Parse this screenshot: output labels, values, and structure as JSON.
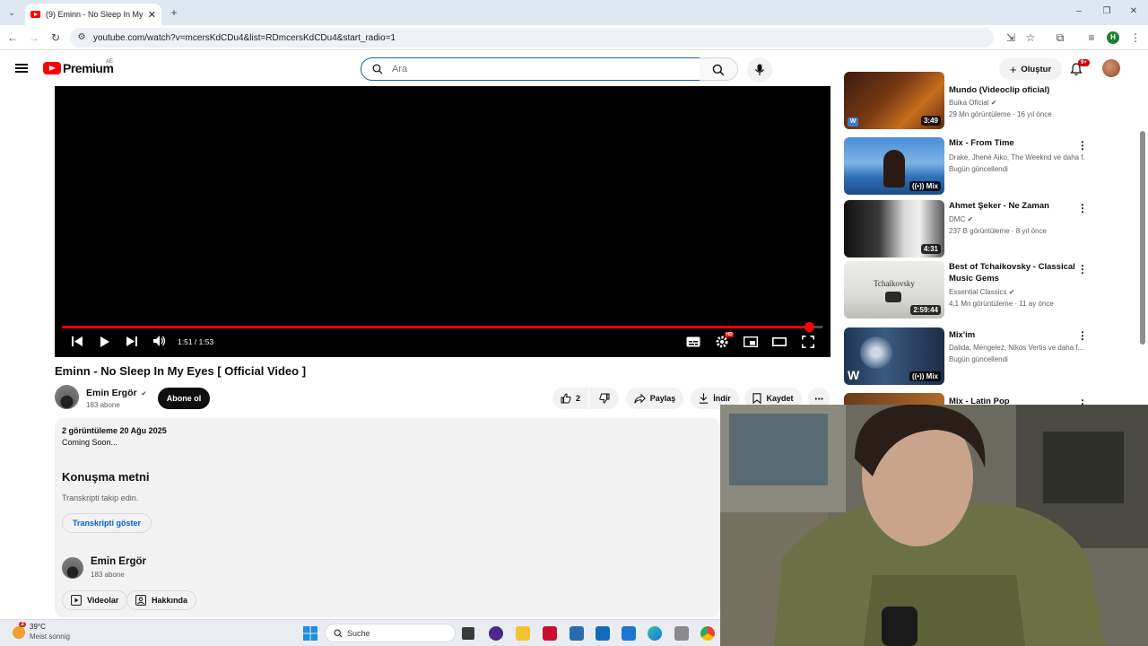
{
  "browser": {
    "tab_title": "(9) Eminn - No Sleep In My Eye",
    "url": "youtube.com/watch?v=mcersKdCDu4&list=RDmcersKdCDu4&start_radio=1"
  },
  "header": {
    "logo_text": "Premium",
    "country": "AE",
    "search_placeholder": "Ara",
    "create_label": "Oluştur",
    "notification_count": "9+"
  },
  "player": {
    "time": "1:51 / 1:53",
    "progress": 0.982
  },
  "video": {
    "title": "Eminn - No Sleep In My Eyes [ Official Video ]",
    "channel": "Emin Ergör",
    "subscribers": "183 abone",
    "subscribe_label": "Abone ol",
    "like_count": "2",
    "share_label": "Paylaş",
    "download_label": "İndir",
    "save_label": "Kaydet"
  },
  "description": {
    "stats": "2 görüntüleme  20 Ağu 2025",
    "text": "Coming Soon...",
    "transcript_heading": "Konuşma metni",
    "transcript_sub": "Transkripti takip edin.",
    "transcript_button": "Transkripti göster",
    "channel": "Emin Ergör",
    "subscribers": "183 abone",
    "videos_label": "Videolar",
    "about_label": "Hakkında"
  },
  "sidebar": [
    {
      "title": "Mundo (Videoclip oficial)",
      "channel": "Buika Oficial",
      "meta": "29 Mn görüntüleme · 16 yıl önce",
      "duration": "3:49"
    },
    {
      "title": "Mix - From Time",
      "channel": "Drake, Jhené Aiko, The Weeknd ve daha f...",
      "meta": "Bugün güncellendi",
      "duration": "Mix"
    },
    {
      "title": "Ahmet Şeker - Ne Zaman",
      "channel": "DMC",
      "meta": "237 B görüntüleme · 8 yıl önce",
      "duration": "4:31"
    },
    {
      "title": "Best of Tchaikovsky - Classical Music Gems",
      "channel": "Essential Classics",
      "meta": "4,1 Mn görüntüleme · 11 ay önce",
      "duration": "2:59:44",
      "thumb_text": "Tchaikovsky"
    },
    {
      "title": "Mix'im",
      "channel": "Dalida, Mengelez, Nikos Vertis ve daha f...",
      "meta": "Bugün güncellendi",
      "duration": "Mix"
    },
    {
      "title": "Mix - Latin Pop"
    }
  ],
  "taskbar": {
    "weather_badge": "2",
    "temperature": "39°C",
    "weather_desc": "Meist sonnig",
    "search_label": "Suche"
  },
  "colors": {
    "youtube_red": "#ff0000",
    "link_blue": "#065fd4",
    "search_border": "#1c62b9"
  }
}
